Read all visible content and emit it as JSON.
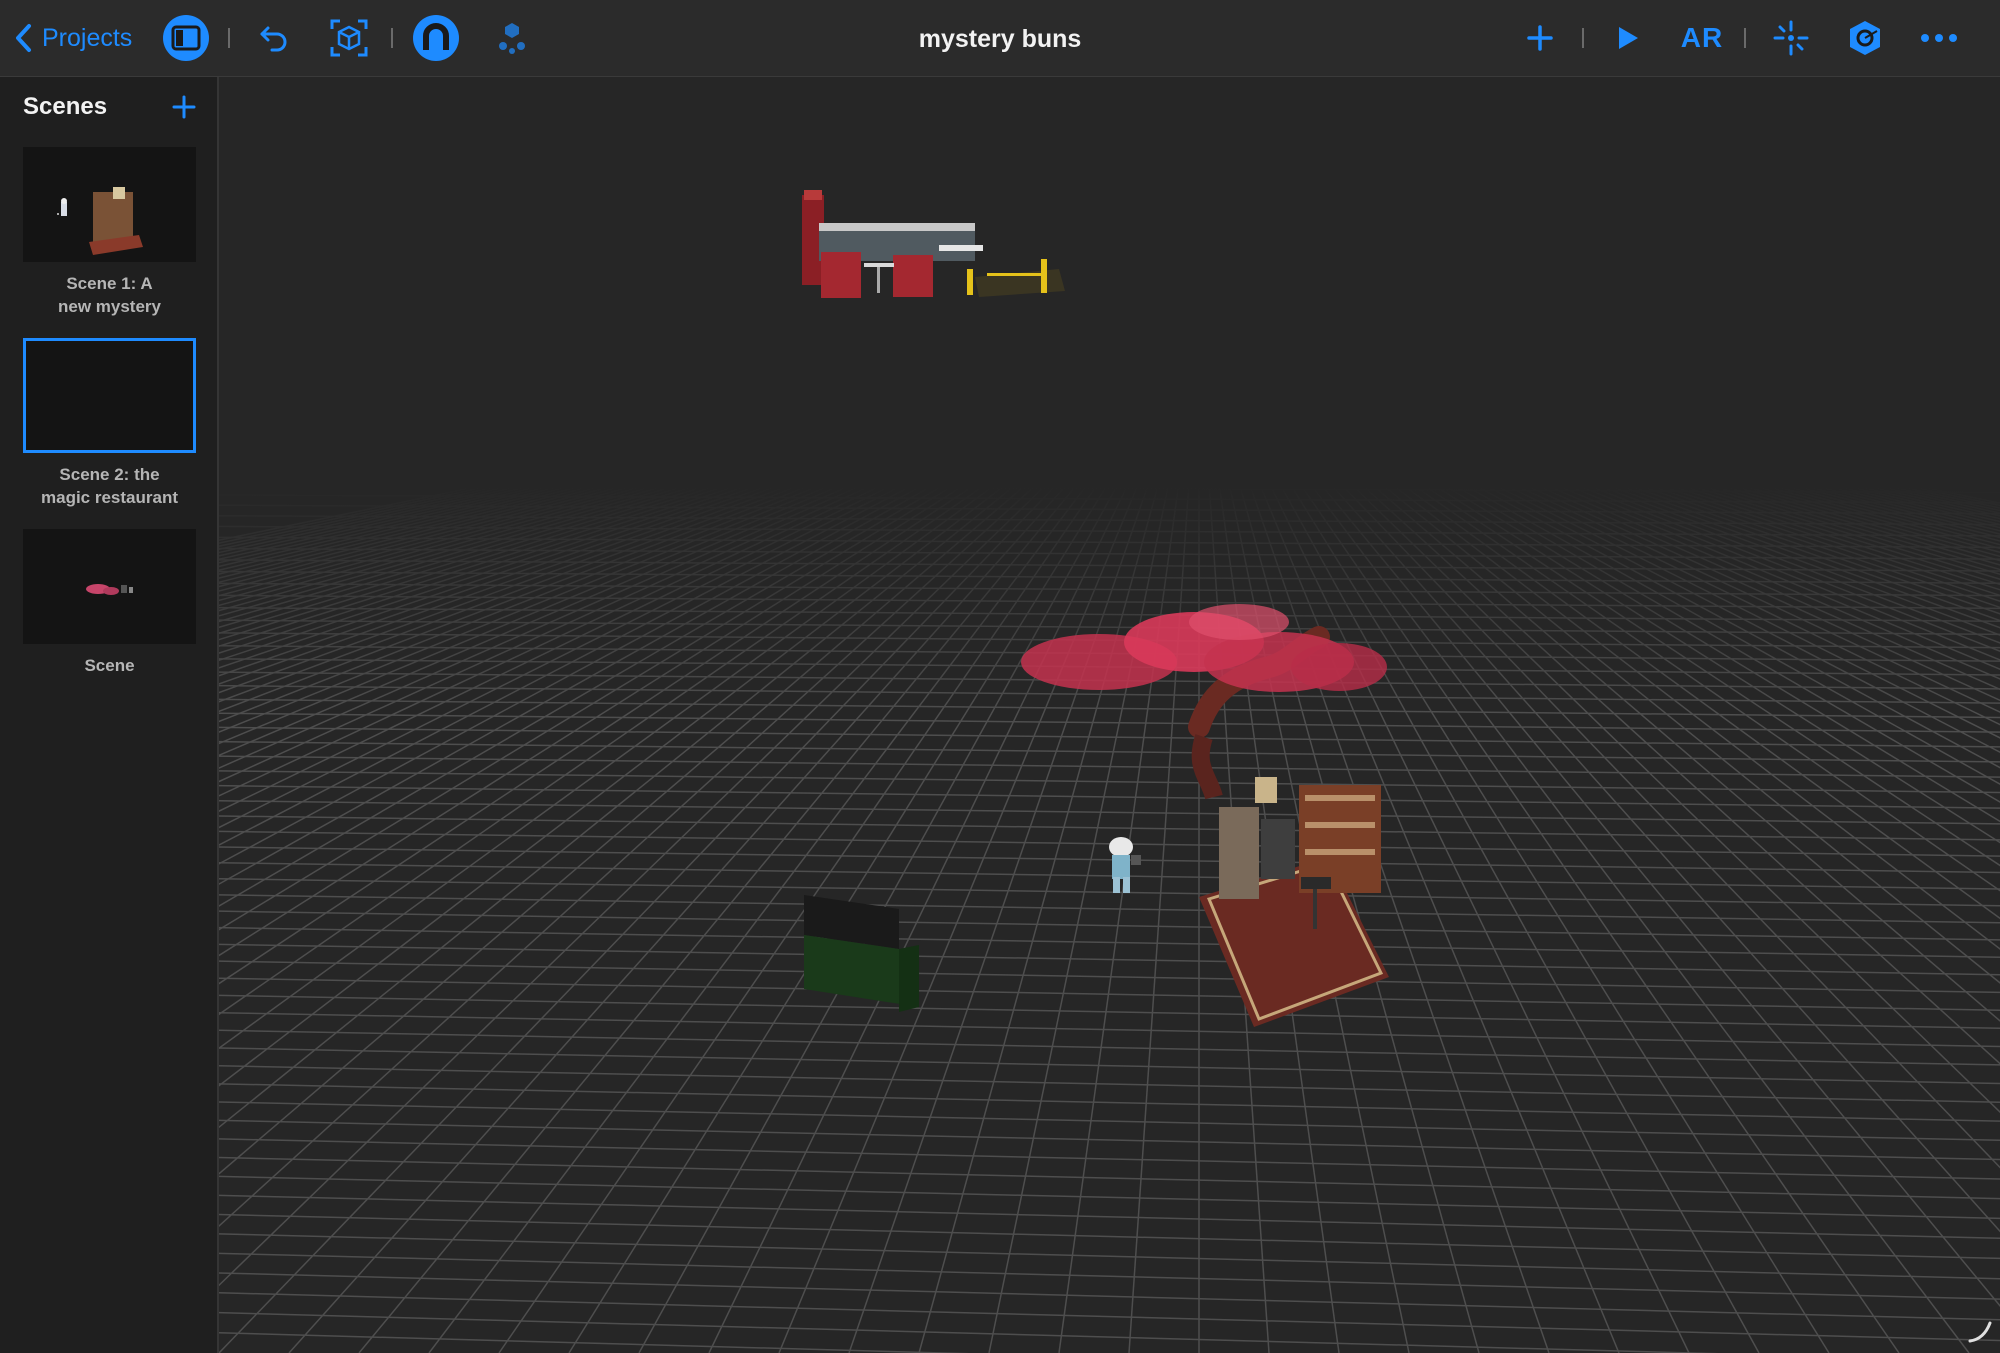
{
  "toolbar": {
    "back_label": "Projects",
    "title": "mystery buns",
    "ar_label": "AR",
    "accent": "#1e8bff",
    "icons": [
      "chevron-left-icon",
      "sidebar-toggle-icon",
      "undo-icon",
      "frame-object-icon",
      "snap-magnet-icon",
      "physics-icon",
      "add-icon",
      "play-icon",
      "ar-icon",
      "anchor-icon",
      "settings-cube-icon",
      "more-icon"
    ]
  },
  "sidebar": {
    "title": "Scenes",
    "scenes": [
      {
        "label_line1": "Scene 1: A",
        "label_line2": "new mystery",
        "selected": false
      },
      {
        "label_line1": "Scene 2: the",
        "label_line2": "magic restaurant",
        "selected": true
      },
      {
        "label_line1": "Scene",
        "label_line2": "",
        "selected": false
      }
    ]
  },
  "viewport": {
    "objects": [
      "diner-booths",
      "cherry-blossom-tree",
      "library-room",
      "character-figure",
      "dumpster"
    ]
  }
}
